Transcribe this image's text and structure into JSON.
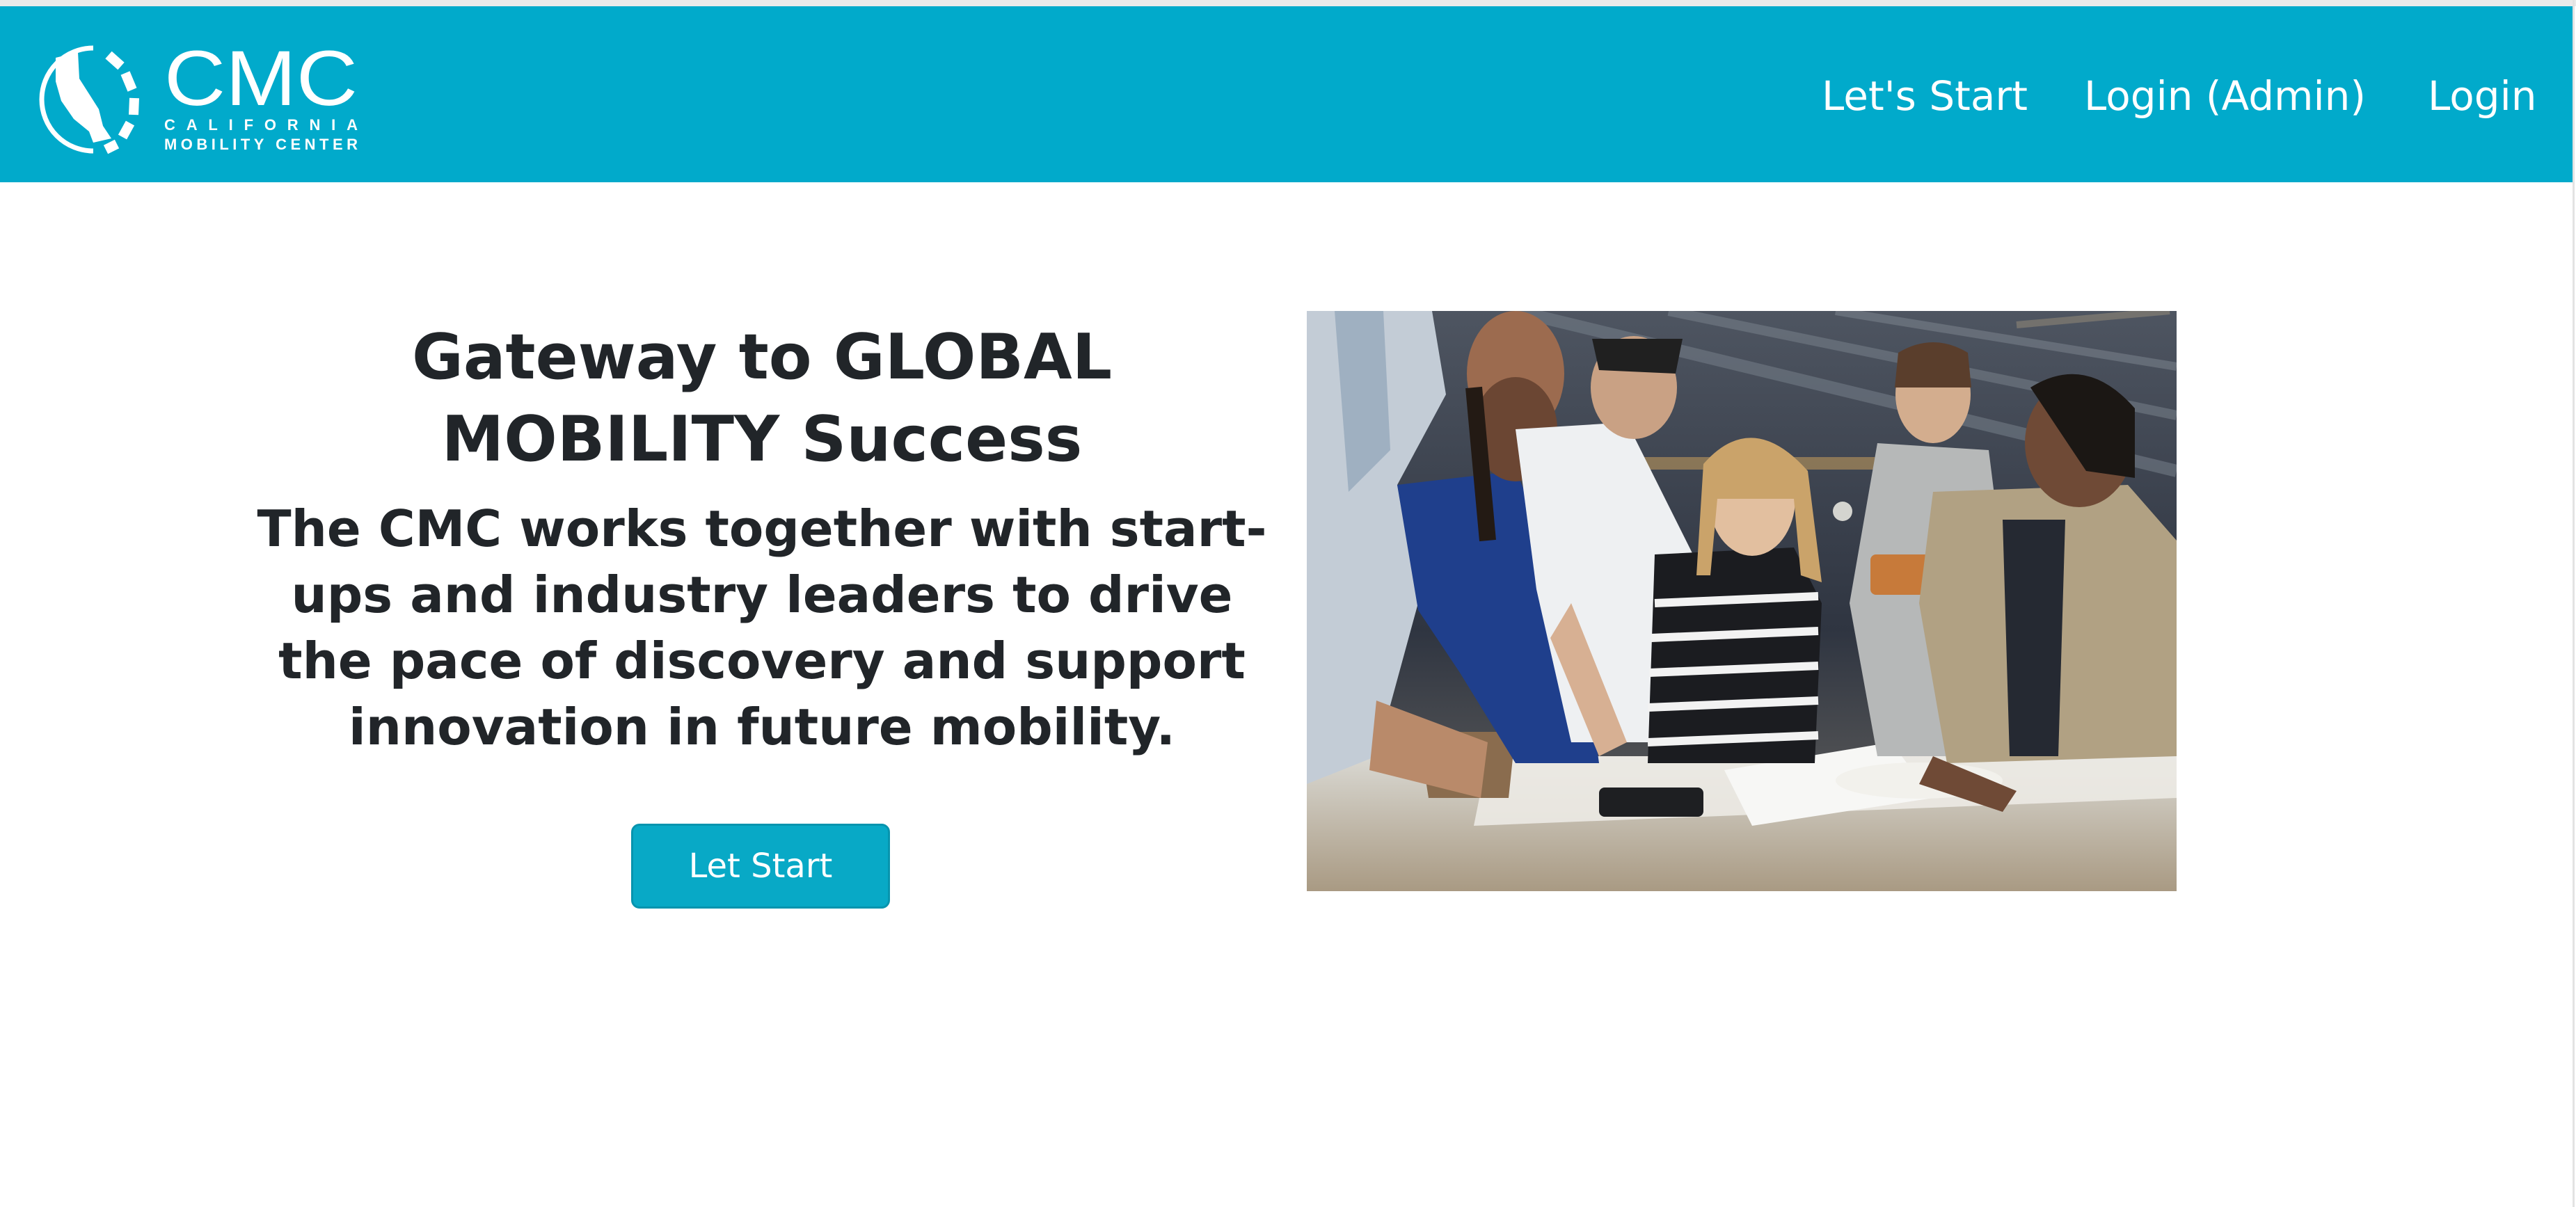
{
  "header": {
    "logo": {
      "wordmark": "CMC",
      "line1": "CALIFORNIA",
      "line2": "MOBILITY CENTER"
    },
    "nav": {
      "lets_start": "Let's Start",
      "login_admin": "Login (Admin)",
      "login": "Login"
    },
    "background_color": "#01aacb"
  },
  "hero": {
    "title": "Gateway to GLOBAL MOBILITY Success",
    "subtitle": "The CMC works together with start-ups and industry leaders to drive the pace of discovery and support innovation in future mobility.",
    "button_label": "Let Start",
    "button_color": "#08a9c6",
    "photo_icon": "team-collaboration-photo"
  }
}
